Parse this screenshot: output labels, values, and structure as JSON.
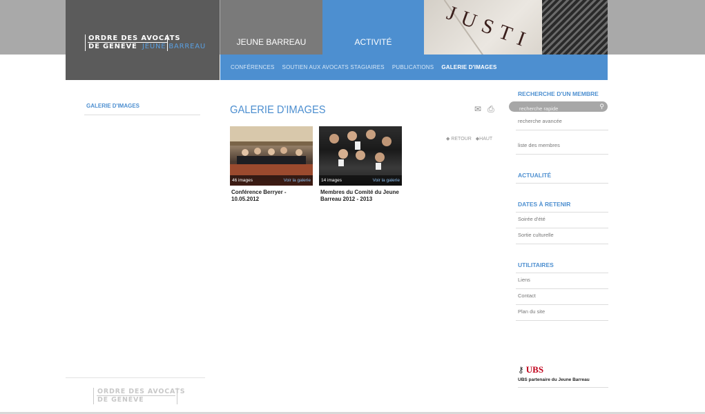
{
  "header": {
    "logo_line1": "ORDRE DES AVOCATS",
    "logo_line2": "DE GENÈVE",
    "logo_jb": "JEUNE BARREAU",
    "nav_jeune_barreau": "JEUNE BARREAU",
    "nav_activite": "ACTIVITÉ",
    "hero_text": "JUSTI"
  },
  "subnav": {
    "items": [
      "CONFÉRENCES",
      "SOUTIEN AUX AVOCATS STAGIAIRES",
      "PUBLICATIONS",
      "GALERIE D'IMAGES"
    ],
    "active_index": 3
  },
  "left": {
    "item": "GALERIE D'IMAGES"
  },
  "main": {
    "title": "GALERIE D'IMAGES",
    "back": "RETOUR",
    "top": "HAUT",
    "galleries": [
      {
        "count": "46 images",
        "view": "Voir la galerie",
        "title": "Conférence Berryer - 10.05.2012"
      },
      {
        "count": "14 images",
        "view": "Voir la galerie",
        "title": "Membres du Comité du Jeune Barreau 2012 - 2013"
      }
    ]
  },
  "right": {
    "search_heading": "RECHERCHE D'UN MEMBRE",
    "search_placeholder": "recherche rapide",
    "advanced": "recherche avancée",
    "members_list": "liste des membres",
    "news_heading": "ACTUALITÉ",
    "dates_heading": "DATES À RETENIR",
    "dates": [
      "Soirée d'été",
      "Sortie culturelle"
    ],
    "utils_heading": "UTILITAIRES",
    "utils": [
      "Liens",
      "Contact",
      "Plan du site"
    ]
  },
  "sponsor": {
    "name": "UBS",
    "tagline": "UBS partenaire du Jeune Barreau"
  },
  "footer": {
    "logo_line1": "ORDRE DES AVOCATS",
    "logo_line2": "DE GENÈVE"
  },
  "colors": {
    "accent": "#4d8fd0",
    "logo_bg": "#5b5b5b",
    "sponsor_red": "#c0001a"
  },
  "icons": {
    "email": "envelope-icon",
    "print": "printer-icon",
    "search": "magnifier-icon"
  }
}
